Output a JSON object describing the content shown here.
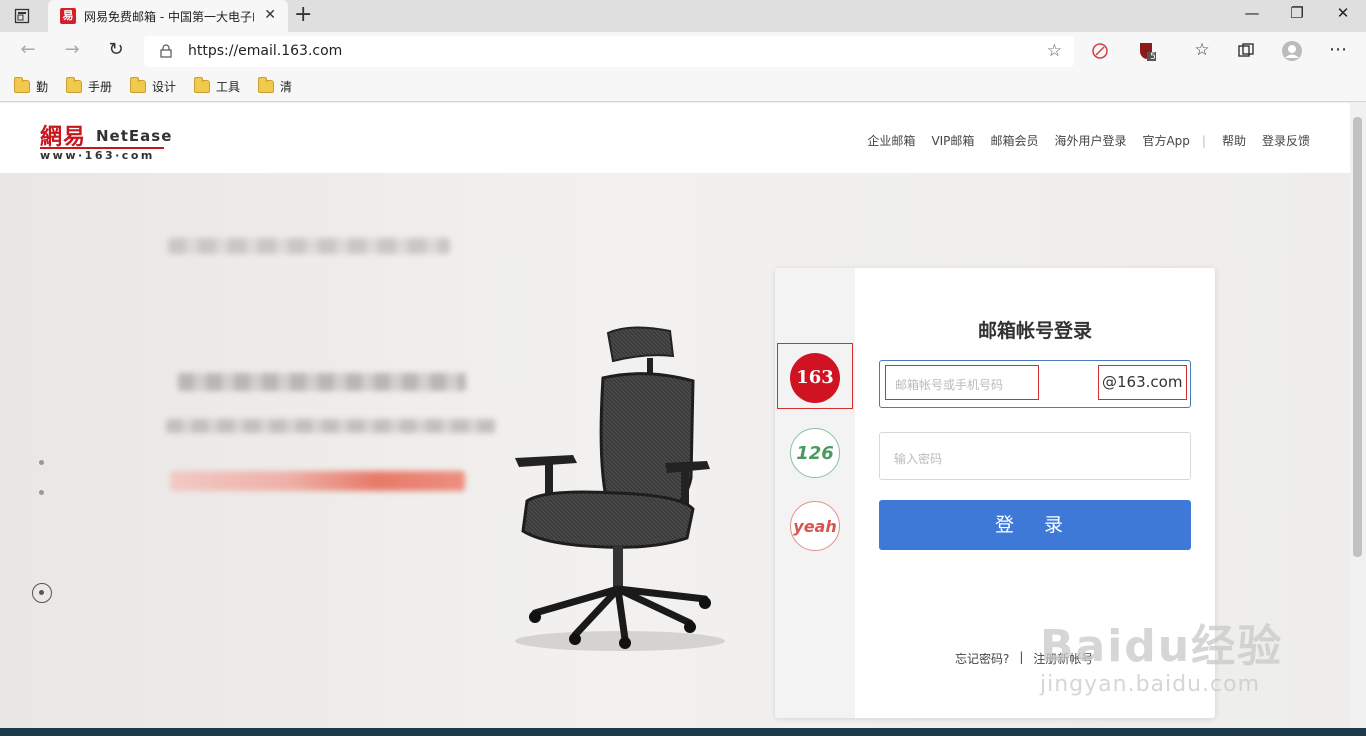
{
  "browser": {
    "tab_title": "网易免费邮箱 - 中国第一大电子邮件服务商",
    "tab_favicon": "易",
    "url": "https://email.163.com",
    "extension_badge": "5",
    "bookmarks": [
      "勤",
      "手册",
      "设计",
      "工具",
      "清"
    ]
  },
  "header": {
    "logo_cn": "網易",
    "logo_en": "NetEase",
    "logo_www": "www·163·com",
    "nav": [
      "企业邮箱",
      "VIP邮箱",
      "邮箱会员",
      "海外用户登录",
      "官方App",
      "帮助",
      "登录反馈"
    ]
  },
  "login": {
    "mailbox_types": [
      "163",
      "126",
      "yeah"
    ],
    "title": "邮箱帐号登录",
    "account_placeholder": "邮箱帐号或手机号码",
    "account_domain": "@163.com",
    "password_placeholder": "输入密码",
    "submit_label": "登  录",
    "forgot_password": "忘记密码?",
    "separator": "|",
    "register": "注册新帐号"
  },
  "watermark": {
    "main": "Baidu经验",
    "sub": "jingyan.baidu.com"
  },
  "colors": {
    "brand_red": "#cf1322",
    "login_blue": "#3f79d8",
    "highlight_box": "#d13030"
  }
}
